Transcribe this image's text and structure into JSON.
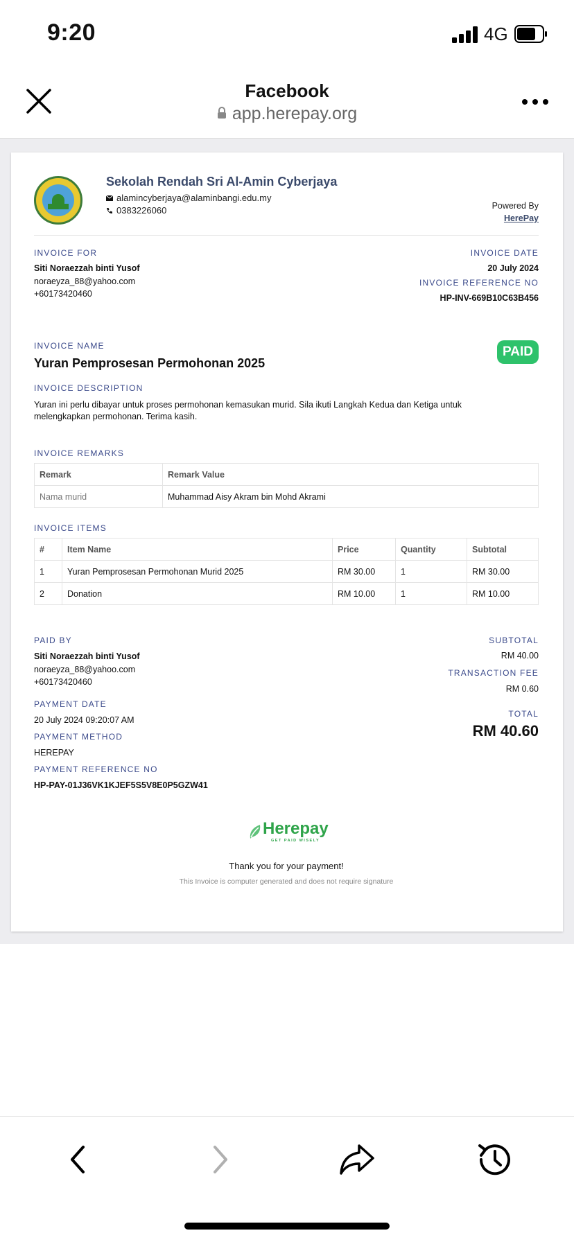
{
  "status_bar": {
    "time": "9:20",
    "network": "4G"
  },
  "browser": {
    "title": "Facebook",
    "url": "app.herepay.org"
  },
  "school": {
    "name": "Sekolah Rendah Sri Al-Amin Cyberjaya",
    "email": "alamincyberjaya@alaminbangi.edu.my",
    "phone": "0383226060"
  },
  "powered": {
    "label": "Powered By",
    "link": "HerePay"
  },
  "invoice_for": {
    "label": "INVOICE FOR",
    "name": "Siti Noraezzah binti Yusof",
    "email": "noraeyza_88@yahoo.com",
    "phone": "+60173420460"
  },
  "invoice_date": {
    "label": "INVOICE DATE",
    "value": "20 July 2024"
  },
  "invoice_ref": {
    "label": "INVOICE REFERENCE NO",
    "value": "HP-INV-669B10C63B456"
  },
  "invoice_name": {
    "label": "INVOICE NAME",
    "value": "Yuran Pemprosesan Permohonan 2025"
  },
  "status_badge": "PAID",
  "description": {
    "label": "INVOICE DESCRIPTION",
    "value": "Yuran ini perlu dibayar untuk proses permohonan kemasukan murid. Sila ikuti Langkah Kedua dan Ketiga untuk melengkapkan permohonan. Terima kasih."
  },
  "remarks": {
    "label": "INVOICE REMARKS",
    "headers": [
      "Remark",
      "Remark Value"
    ],
    "rows": [
      [
        "Nama murid",
        "Muhammad Aisy Akram bin Mohd Akrami"
      ]
    ]
  },
  "items": {
    "label": "INVOICE ITEMS",
    "headers": [
      "#",
      "Item Name",
      "Price",
      "Quantity",
      "Subtotal"
    ],
    "rows": [
      [
        "1",
        "Yuran Pemprosesan Permohonan Murid 2025",
        "RM 30.00",
        "1",
        "RM 30.00"
      ],
      [
        "2",
        "Donation",
        "RM 10.00",
        "1",
        "RM 10.00"
      ]
    ]
  },
  "paid_by": {
    "label": "PAID BY",
    "name": "Siti Noraezzah binti Yusof",
    "email": "noraeyza_88@yahoo.com",
    "phone": "+60173420460"
  },
  "payment_date": {
    "label": "PAYMENT DATE",
    "value": "20 July 2024 09:20:07 AM"
  },
  "payment_method": {
    "label": "PAYMENT METHOD",
    "value": "HEREPAY"
  },
  "payment_ref": {
    "label": "PAYMENT REFERENCE NO",
    "value": "HP-PAY-01J36VK1KJEF5S5V8E0P5GZW41"
  },
  "totals": {
    "subtotal_label": "SUBTOTAL",
    "subtotal": "RM 40.00",
    "fee_label": "TRANSACTION FEE",
    "fee": "RM 0.60",
    "total_label": "TOTAL",
    "total": "RM 40.60"
  },
  "footer": {
    "logo_text": "Herepay",
    "logo_tagline": "GET PAID WISELY",
    "thanks": "Thank you for your payment!",
    "note": "This Invoice is computer generated and does not require signature"
  },
  "colors": {
    "accent": "#3b4a8b",
    "paid": "#2ec26b",
    "brand_green": "#2fa44a"
  }
}
